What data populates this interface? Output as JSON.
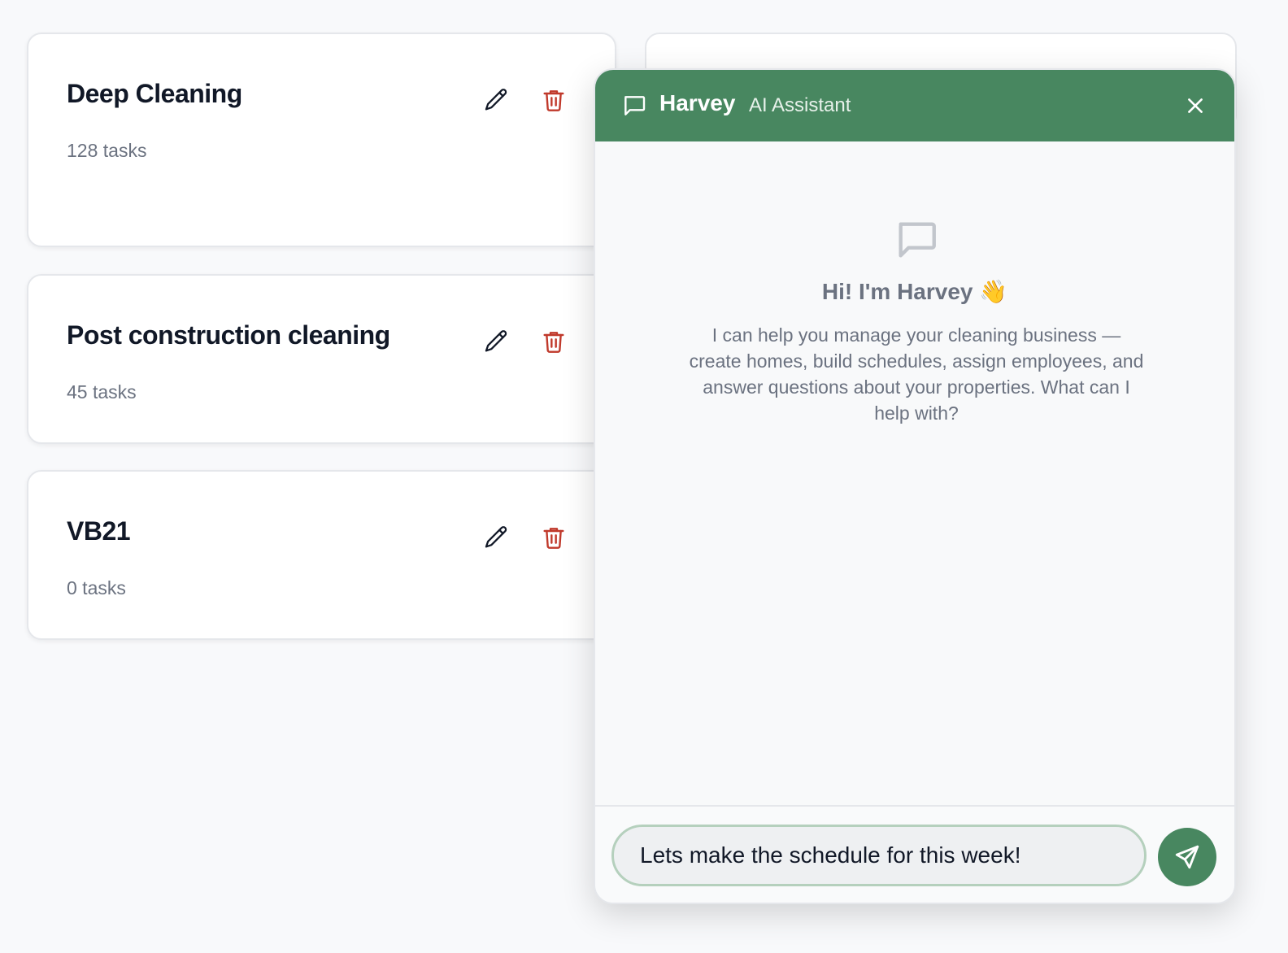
{
  "cards": [
    {
      "title": "Deep Cleaning",
      "tasks": "128 tasks"
    },
    {
      "title": "Post construction cleaning",
      "tasks": "45 tasks"
    },
    {
      "title": "VB21",
      "tasks": "0 tasks"
    }
  ],
  "icons": {
    "edit": "pencil-icon",
    "delete": "trash-icon",
    "chat": "chat-bubble-icon",
    "close": "close-icon",
    "send": "send-icon"
  },
  "colors": {
    "brand_green": "#488760",
    "delete_red": "#c0392b",
    "input_border": "#b5d0bd"
  },
  "chat": {
    "title": "Harvey",
    "subtitle": "AI Assistant",
    "welcome_title": "Hi! I'm Harvey 👋",
    "welcome_text": "I can help you manage your cleaning business — create homes, build schedules, assign employees, and answer questions about your properties. What can I help with?",
    "input_value": "Lets make the schedule for this week!"
  }
}
